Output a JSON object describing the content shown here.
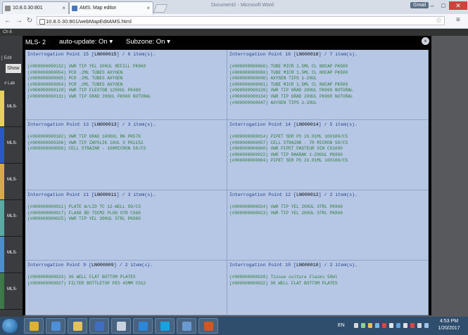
{
  "browser": {
    "tabs": [
      {
        "title": "10.8.0.30:801"
      },
      {
        "title": "AMS: Map editor"
      }
    ],
    "background_window_title": "Document1 - Microsoft Word",
    "user_badge": "Gmail",
    "address": "10.8.0.30:801/webMapEditAMS.html"
  },
  "page": {
    "top_text": "Ch 8",
    "edit_fragment": "[ Edit",
    "show_button": "Show",
    "lab_fragment": "#   Lab",
    "side_labels": [
      "MLS-",
      "MLS-",
      "MLS-",
      "MLS-",
      "MLS-",
      "MLS-"
    ],
    "side_colors": [
      "#e9cf60",
      "#2a58c9",
      "#d7a94d",
      "#5aa9a3",
      "#4b8ec9",
      "#3d7a47"
    ]
  },
  "modal": {
    "mls_label": "MLS- 2",
    "auto_update": "auto-update: On",
    "subzone": "Subzone: On",
    "close": "×"
  },
  "cells": [
    {
      "point": "Interrogation Point 15",
      "code": "LN000015",
      "count": "6 item(s).",
      "items": [
        "(#000000000132) VWR TIP YEL 200UL REFILL PK960",
        "(#000000000054) PCR .2ML TUBES AXYGEN",
        "(#000000000065) PCR .2ML TUBES AXYGEN",
        "(#000000000054) PCR .2ML TUBES AXYGEN",
        "(#000000000129) VWR TIP FLEXTOB 1250UL PK480",
        "(#000000000131) VWR TIP GRAD 200UL PK960 NUTURAL"
      ]
    },
    {
      "point": "Interrogation Point 16",
      "code": "LN000016",
      "count": "7 item(s).",
      "items": [
        "(#000000000066) TUBE MICR 1.5ML CL NOCAP PK500",
        "(#000000000060) TUBE MICR 1.5ML CL NOCAP PK500",
        "(#000000000048) AXYGEN TIPS 1-20UL",
        "(#000000000061) TUBE MICR 1.5ML CL NOCAP PK500",
        "(#000000000130) VWR TIP GRAD 200UL PK960 NUTURAL",
        "(#000000000134) VWR TIP GRAD 200UL PK960 NUTURAL",
        "(#000000000047) AXYGEN TIPS 1-20UL"
      ]
    },
    {
      "point": "Interrogation Point 13",
      "code": "LN000013",
      "count": "3 item(s).",
      "items": [
        "(#000000000102) VWR TIP GRAD 1000UL RK PK576",
        "(#000000000106) VWR TIP ZAPSLIK 10UL S PK1152",
        "(#000000000058) CELL STRAINR - 100MICRON 50/CS"
      ]
    },
    {
      "point": "Interrogation Point 14",
      "code": "LN000014",
      "count": "5 item(s).",
      "items": [
        "(#000000000014) PIPET SER PS 2X.01ML 10X100/CS",
        "(#000000000057) CELL STRAINR - 70 MICRON 50/CS",
        "(#000000000068) VWR PIPET PASTEUR 9IN CS1000",
        "(#000000000022) VWR TIP RAKRAK 1-200UL PK960",
        "(#000000000004) PIPET SER PS 2X.01ML 10X100/CS"
      ]
    },
    {
      "point": "Interrogation Point 11",
      "code": "LN000011",
      "count": "3 item(s).",
      "items": [
        "(#000000000011) PLATE W/LID TC 12-WELL 50/CS",
        "(#000000000017) FLASK BD 75CM2 PLUG STR CS60",
        "(#000000000025) VWR TIP YEL 200UL STRL PK960"
      ]
    },
    {
      "point": "Interrogation Point 12",
      "code": "LN000012",
      "count": "2 item(s).",
      "items": [
        "(#000000000024) VWR TIP YEL 200UL STRL PK960",
        "(#000000000023) VWR TIP YEL 200UL STRL PK960"
      ]
    },
    {
      "point": "Interrogation Point 9",
      "code": "LN000009",
      "count": "2 item(s).",
      "items": [
        "(#000000000033) 96 WELL FLAT BOTTOM PLATES",
        "(#000000000027) FILTER BOTTLETOP PES 45MM CS12"
      ]
    },
    {
      "point": "Interrogation Point 10",
      "code": "LN000010",
      "count": "2 item(s).",
      "items": [
        "(#000000000028) Tissue culture Flasks 50ml",
        "(#000000000032) 96 WELL FLAT BOTTOM PLATES"
      ]
    }
  ],
  "taskbar": {
    "language": "EN",
    "time": "4:53 PM",
    "date": "1/20/2017",
    "apps": [
      "chrome",
      "paint",
      "explorer",
      "word",
      "notepad",
      "teamviewer",
      "skype",
      "remote-desktop",
      "powerpoint"
    ],
    "app_colors": [
      "#e0b030",
      "#4f8fd8",
      "#e3c25a",
      "#3f6fc4",
      "#c8d2de",
      "#2d86d8",
      "#1aa0e0",
      "#6c9ad0",
      "#d2562a"
    ]
  }
}
